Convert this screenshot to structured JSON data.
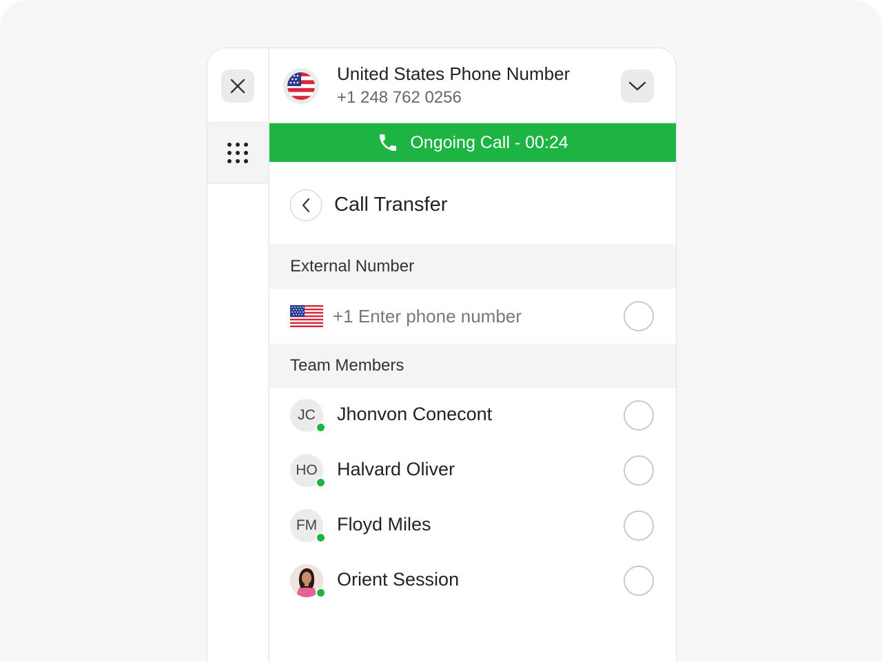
{
  "header": {
    "title": "United States Phone Number",
    "phone": "+1 248 762 0256",
    "flag_icon": "us-flag-icon",
    "dropdown_icon": "chevron-down-icon"
  },
  "rail": {
    "close_icon": "close-icon",
    "keypad_icon": "dialpad-icon"
  },
  "call_status": {
    "text": "Ongoing Call - 00:24",
    "icon": "phone-icon",
    "color": "#1db444"
  },
  "page": {
    "title": "Call Transfer",
    "back_icon": "chevron-left-icon"
  },
  "external": {
    "label": "External Number",
    "country_code": "+1",
    "placeholder": "+1 Enter phone number",
    "value": ""
  },
  "team": {
    "label": "Team Members",
    "members": [
      {
        "initials": "JC",
        "name": "Jhonvon Conecont",
        "status": "online",
        "selected": false
      },
      {
        "initials": "HO",
        "name": "Halvard Oliver",
        "status": "online",
        "selected": false
      },
      {
        "initials": "FM",
        "name": "Floyd Miles",
        "status": "online",
        "selected": false
      },
      {
        "initials": "",
        "name": "Orient Session",
        "status": "online",
        "selected": false,
        "avatar": "photo"
      }
    ]
  },
  "colors": {
    "accent_green": "#1db444",
    "us_red": "#d72638",
    "us_blue": "#2b3a8f"
  }
}
